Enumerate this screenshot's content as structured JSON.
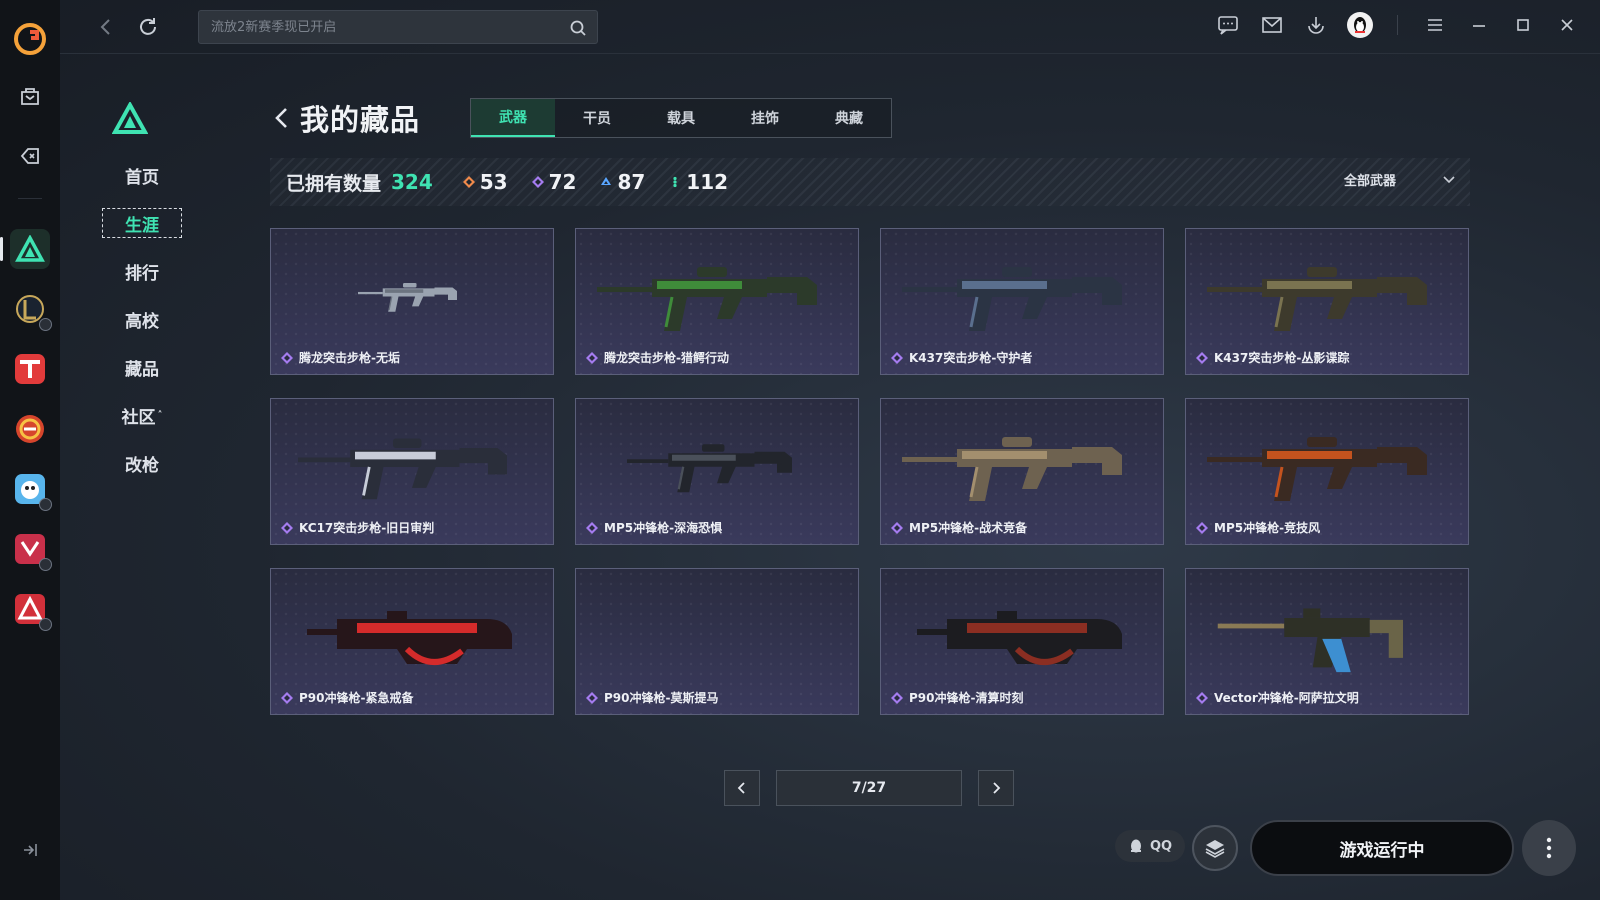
{
  "search": {
    "placeholder": "流放2新赛季现已开启"
  },
  "sidebar": {
    "items": [
      {
        "label": "首页",
        "active": false
      },
      {
        "label": "生涯",
        "active": true
      },
      {
        "label": "排行",
        "active": false
      },
      {
        "label": "高校",
        "active": false
      },
      {
        "label": "藏品",
        "active": false
      },
      {
        "label": "社区",
        "active": false,
        "has_chevron": true
      },
      {
        "label": "改枪",
        "active": false
      }
    ]
  },
  "main": {
    "title": "我的藏品",
    "tabs": [
      {
        "label": "武器",
        "active": true
      },
      {
        "label": "干员",
        "active": false
      },
      {
        "label": "载具",
        "active": false
      },
      {
        "label": "挂饰",
        "active": false
      },
      {
        "label": "典藏",
        "active": false
      }
    ],
    "stats": {
      "owned_label": "已拥有数量",
      "owned_count": "324",
      "tiers": [
        {
          "count": "53",
          "color": "#f08a4b"
        },
        {
          "count": "72",
          "color": "#a57cf0"
        },
        {
          "count": "87",
          "color": "#5aa6ff"
        },
        {
          "count": "112",
          "color": "#3fe3b2"
        }
      ]
    },
    "filter": {
      "label": "全部武器"
    },
    "items": [
      {
        "name": "腾龙突击步枪-无垢",
        "art": "rifle-small"
      },
      {
        "name": "腾龙突击步枪-猎鳄行动",
        "art": "rifle-green"
      },
      {
        "name": "K437突击步枪-守护者",
        "art": "rifle-blue"
      },
      {
        "name": "K437突击步枪-丛影谍踪",
        "art": "rifle-camo"
      },
      {
        "name": "KC17突击步枪-旧日审判",
        "art": "rifle-white"
      },
      {
        "name": "MP5冲锋枪-深海恐惧",
        "art": "smg-dark"
      },
      {
        "name": "MP5冲锋枪-战术竞备",
        "art": "smg-desert"
      },
      {
        "name": "MP5冲锋枪-竞技风",
        "art": "smg-orange"
      },
      {
        "name": "P90冲锋枪-紧急戒备",
        "art": "p90-red"
      },
      {
        "name": "P90冲锋枪-莫斯提马",
        "art": "empty"
      },
      {
        "name": "P90冲锋枪-清算时刻",
        "art": "p90-black"
      },
      {
        "name": "Vector冲锋枪-阿萨拉文明",
        "art": "vector"
      }
    ],
    "pager": {
      "current": "7/27"
    }
  },
  "footer": {
    "qq_label": "QQ",
    "run_label": "游戏运行中"
  },
  "colors": {
    "accent": "#3fe3b2",
    "item_gem": "#a57cf0"
  }
}
